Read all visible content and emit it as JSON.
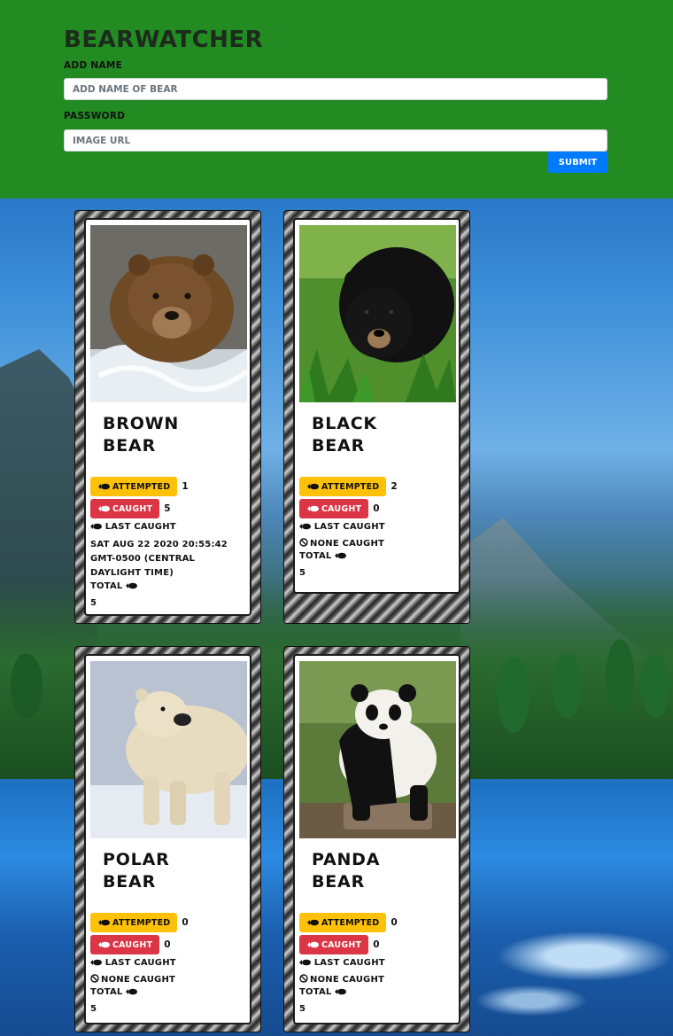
{
  "header": {
    "brand": "BEARWATCHER",
    "name_label": "ADD NAME",
    "name_placeholder": "ADD NAME OF BEAR",
    "password_label": "PASSWORD",
    "image_placeholder": "IMAGE URL",
    "submit_label": "SUBMIT"
  },
  "labels": {
    "attempted": "ATTEMPTED",
    "caught": "CAUGHT",
    "last_caught": "LAST CAUGHT",
    "none_caught": "NONE CAUGHT",
    "total": "TOTAL"
  },
  "bears": [
    {
      "name": "BROWN\nBEAR",
      "attempted": "1",
      "caught": "5",
      "last_caught_value": "SAT AUG 22 2020 20:55:42 GMT-0500 (CENTRAL DAYLIGHT TIME)",
      "total": "5"
    },
    {
      "name": "BLACK\nBEAR",
      "attempted": "2",
      "caught": "0",
      "last_caught_value": "",
      "total": "5"
    },
    {
      "name": "POLAR\nBEAR",
      "attempted": "0",
      "caught": "0",
      "last_caught_value": "",
      "total": "5"
    },
    {
      "name": "PANDA\nBEAR",
      "attempted": "0",
      "caught": "0",
      "last_caught_value": "",
      "total": "5"
    }
  ],
  "colors": {
    "header_bg": "#228b22",
    "attempted_badge": "#ffc107",
    "caught_badge": "#dc3545",
    "submit_button": "#007bff"
  },
  "icons": {
    "fish": "fish-icon",
    "none": "ban-icon"
  }
}
